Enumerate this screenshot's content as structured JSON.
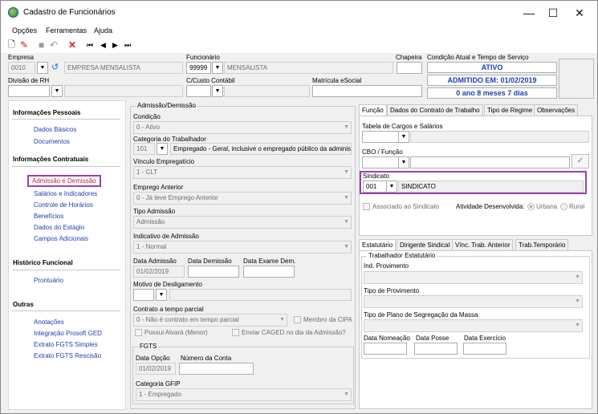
{
  "window": {
    "title": "Cadastro de Funcionários",
    "minimize": "—",
    "maximize": "☐",
    "close": "✕"
  },
  "menu": {
    "options": "Opções",
    "tools": "Ferramentas",
    "help": "Ajuda"
  },
  "header": {
    "empresa_label": "Empresa",
    "empresa_code": "0010",
    "empresa_name": "EMPRESA MENSALISTA",
    "funcionario_label": "Funcionário",
    "funcionario_code": "99999",
    "funcionario_name": "MENSALISTA",
    "chapeira_label": "Chapeira",
    "condicao_label": "Condição Atual e Tempo de Serviço",
    "status_ativo": "ATIVO",
    "status_admitido": "ADMITIDO EM: 01/02/2019",
    "status_tempo": "0 ano 8 meses 7 dias",
    "divisao_label": "Divisão de RH",
    "ccusto_label": "C/Custo Contábil",
    "matricula_label": "Matrícula eSocial"
  },
  "sidebar": {
    "pessoais": "Informações Pessoais",
    "dados_basicos": "Dados Básicos",
    "documentos": "Documentos",
    "contratuais": "Informações Contratuais",
    "admissao": "Admissão e Demissão",
    "salarios": "Salários e Indicadores",
    "horarios": "Controle de Horários",
    "beneficios": "Benefícios",
    "estagio": "Dados do Estágio",
    "campos": "Campos Adicionais",
    "historico": "Histórico Funcional",
    "prontuario": "Prontuário",
    "outras": "Outras",
    "anotacoes": "Anotações",
    "prosoft": "Integração Prosoft GED",
    "fgts_simples": "Extrato FGTS Simples",
    "fgts_rescisao": "Extrato FGTS Rescisão"
  },
  "admissao": {
    "group": "Admissão/Demissão",
    "condicao_label": "Condição",
    "condicao_value": "0 - Ativo",
    "categoria_label": "Categoria do Trabalhador",
    "categoria_code": "101",
    "categoria_value": "Empregado - Geral, inclusive o empregado público da administ",
    "vinculo_label": "Vínculo Empregatício",
    "vinculo_value": "1 - CLT",
    "empregoant_label": "Emprego Anterior",
    "empregoant_value": "0 - Já teve Emprego Anterior",
    "tipo_label": "Tipo Admissão",
    "tipo_value": "Admissão",
    "indicativo_label": "Indicativo de Admissão",
    "indicativo_value": "1 - Normal",
    "data_adm_label": "Data Admissão",
    "data_adm_value": "01/02/2019",
    "data_dem_label": "Data Demissão",
    "data_exame_label": "Data Exame Dem.",
    "motivo_label": "Motivo de Desligamento",
    "parcial_label": "Contrato a tempo parcial",
    "parcial_value": "0 - Não é contrato em tempo parcial",
    "cipa_label": "Membro da CIPA",
    "alvara_label": "Possui Alvará (Menor)",
    "caged_label": "Enviar CAGED no dia da Admissão?"
  },
  "fgts": {
    "group": "FGTS",
    "data_label": "Data Opção",
    "data_value": "01/02/2019",
    "conta_label": "Número da Conta",
    "gfip_label": "Categoria GFIP",
    "gfip_value": "1 - Empregado"
  },
  "tabs_top": [
    "Função",
    "Dados do Contrato de Trabalho",
    "Tipo de Regime",
    "Observações"
  ],
  "funcao": {
    "tabela_label": "Tabela de Cargos e Salários",
    "cbo_label": "CBO / Função",
    "sindicato_label": "Sindicato",
    "sindicato_code": "001",
    "sindicato_name": "SINDICATO",
    "associado_label": "Associado ao Sindicato",
    "atividade_label": "Atividade Desenvolvida:",
    "urbana": "Urbana",
    "rural": "Rural"
  },
  "tabs_bottom": [
    "Estatutário",
    "Dirigente Sindical",
    "Vínc. Trab. Anterior",
    "Trab.Temporário"
  ],
  "estatutario": {
    "group": "Trabalhador Estatutário",
    "ind_label": "Ind. Provimento",
    "tipo_label": "Tipo de Provimento",
    "plano_label": "Tipo de Plano de Segregação da Massa",
    "nomeacao_label": "Data Nomeação",
    "posse_label": "Data Posse",
    "exercicio_label": "Data Exercício"
  },
  "colors": {
    "accent_link": "#1f3eb3",
    "selected_link": "#cc1e28",
    "highlight_border": "#9b3fb0"
  }
}
